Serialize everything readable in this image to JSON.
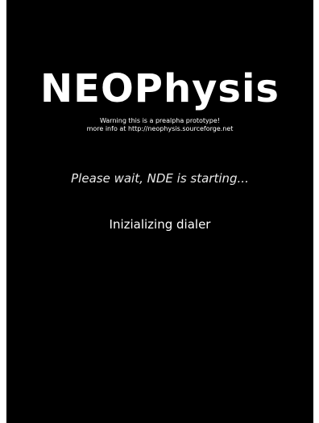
{
  "splash": {
    "logo_text": "NEOPhysis",
    "warning_line1": "Warning this is a prealpha prototype!",
    "warning_line2": "more info at http://neophysis.sourceforge.net",
    "status_text": "Please wait, NDE is starting...",
    "progress_step": "Inizializing dialer"
  },
  "colors": {
    "background": "#000000",
    "text": "#ffffff"
  }
}
